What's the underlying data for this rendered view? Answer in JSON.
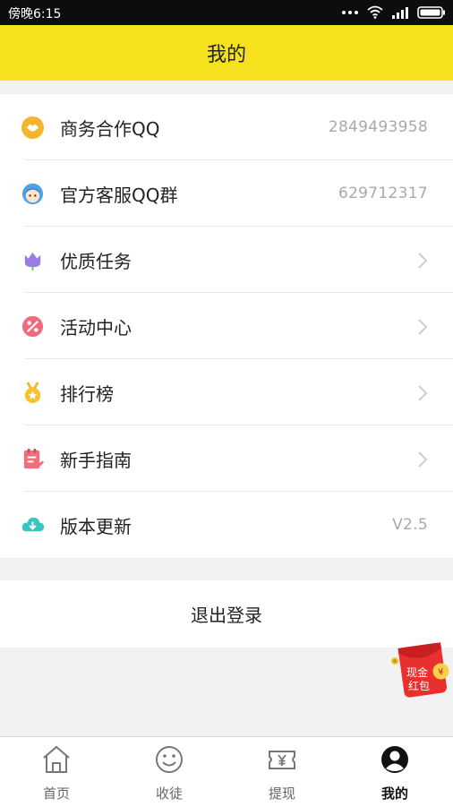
{
  "status_bar": {
    "time": "傍晚6:15"
  },
  "header": {
    "title": "我的"
  },
  "menu": [
    {
      "label": "商务合作QQ",
      "value": "2849493958"
    },
    {
      "label": "官方客服QQ群",
      "value": "629712317"
    },
    {
      "label": "优质任务",
      "value": ""
    },
    {
      "label": "活动中心",
      "value": ""
    },
    {
      "label": "排行榜",
      "value": ""
    },
    {
      "label": "新手指南",
      "value": ""
    },
    {
      "label": "版本更新",
      "value": "V2.5"
    }
  ],
  "logout_label": "退出登录",
  "red_packet": {
    "line1": "现金",
    "line2": "红包"
  },
  "tabs": [
    {
      "label": "首页",
      "icon": "home-icon"
    },
    {
      "label": "收徒",
      "icon": "smiley-icon"
    },
    {
      "label": "提现",
      "icon": "ticket-icon"
    },
    {
      "label": "我的",
      "icon": "user-icon",
      "active": true
    }
  ],
  "colors": {
    "accent": "#f5e11d",
    "background": "#f2f2f2"
  }
}
